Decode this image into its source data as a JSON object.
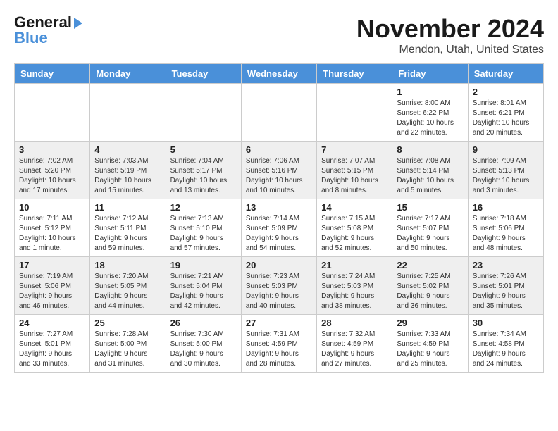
{
  "header": {
    "logo_general": "General",
    "logo_blue": "Blue",
    "month_title": "November 2024",
    "location": "Mendon, Utah, United States"
  },
  "calendar": {
    "days_of_week": [
      "Sunday",
      "Monday",
      "Tuesday",
      "Wednesday",
      "Thursday",
      "Friday",
      "Saturday"
    ],
    "weeks": [
      [
        {
          "day": "",
          "info": ""
        },
        {
          "day": "",
          "info": ""
        },
        {
          "day": "",
          "info": ""
        },
        {
          "day": "",
          "info": ""
        },
        {
          "day": "",
          "info": ""
        },
        {
          "day": "1",
          "info": "Sunrise: 8:00 AM\nSunset: 6:22 PM\nDaylight: 10 hours\nand 22 minutes."
        },
        {
          "day": "2",
          "info": "Sunrise: 8:01 AM\nSunset: 6:21 PM\nDaylight: 10 hours\nand 20 minutes."
        }
      ],
      [
        {
          "day": "3",
          "info": "Sunrise: 7:02 AM\nSunset: 5:20 PM\nDaylight: 10 hours\nand 17 minutes."
        },
        {
          "day": "4",
          "info": "Sunrise: 7:03 AM\nSunset: 5:19 PM\nDaylight: 10 hours\nand 15 minutes."
        },
        {
          "day": "5",
          "info": "Sunrise: 7:04 AM\nSunset: 5:17 PM\nDaylight: 10 hours\nand 13 minutes."
        },
        {
          "day": "6",
          "info": "Sunrise: 7:06 AM\nSunset: 5:16 PM\nDaylight: 10 hours\nand 10 minutes."
        },
        {
          "day": "7",
          "info": "Sunrise: 7:07 AM\nSunset: 5:15 PM\nDaylight: 10 hours\nand 8 minutes."
        },
        {
          "day": "8",
          "info": "Sunrise: 7:08 AM\nSunset: 5:14 PM\nDaylight: 10 hours\nand 5 minutes."
        },
        {
          "day": "9",
          "info": "Sunrise: 7:09 AM\nSunset: 5:13 PM\nDaylight: 10 hours\nand 3 minutes."
        }
      ],
      [
        {
          "day": "10",
          "info": "Sunrise: 7:11 AM\nSunset: 5:12 PM\nDaylight: 10 hours\nand 1 minute."
        },
        {
          "day": "11",
          "info": "Sunrise: 7:12 AM\nSunset: 5:11 PM\nDaylight: 9 hours\nand 59 minutes."
        },
        {
          "day": "12",
          "info": "Sunrise: 7:13 AM\nSunset: 5:10 PM\nDaylight: 9 hours\nand 57 minutes."
        },
        {
          "day": "13",
          "info": "Sunrise: 7:14 AM\nSunset: 5:09 PM\nDaylight: 9 hours\nand 54 minutes."
        },
        {
          "day": "14",
          "info": "Sunrise: 7:15 AM\nSunset: 5:08 PM\nDaylight: 9 hours\nand 52 minutes."
        },
        {
          "day": "15",
          "info": "Sunrise: 7:17 AM\nSunset: 5:07 PM\nDaylight: 9 hours\nand 50 minutes."
        },
        {
          "day": "16",
          "info": "Sunrise: 7:18 AM\nSunset: 5:06 PM\nDaylight: 9 hours\nand 48 minutes."
        }
      ],
      [
        {
          "day": "17",
          "info": "Sunrise: 7:19 AM\nSunset: 5:06 PM\nDaylight: 9 hours\nand 46 minutes."
        },
        {
          "day": "18",
          "info": "Sunrise: 7:20 AM\nSunset: 5:05 PM\nDaylight: 9 hours\nand 44 minutes."
        },
        {
          "day": "19",
          "info": "Sunrise: 7:21 AM\nSunset: 5:04 PM\nDaylight: 9 hours\nand 42 minutes."
        },
        {
          "day": "20",
          "info": "Sunrise: 7:23 AM\nSunset: 5:03 PM\nDaylight: 9 hours\nand 40 minutes."
        },
        {
          "day": "21",
          "info": "Sunrise: 7:24 AM\nSunset: 5:03 PM\nDaylight: 9 hours\nand 38 minutes."
        },
        {
          "day": "22",
          "info": "Sunrise: 7:25 AM\nSunset: 5:02 PM\nDaylight: 9 hours\nand 36 minutes."
        },
        {
          "day": "23",
          "info": "Sunrise: 7:26 AM\nSunset: 5:01 PM\nDaylight: 9 hours\nand 35 minutes."
        }
      ],
      [
        {
          "day": "24",
          "info": "Sunrise: 7:27 AM\nSunset: 5:01 PM\nDaylight: 9 hours\nand 33 minutes."
        },
        {
          "day": "25",
          "info": "Sunrise: 7:28 AM\nSunset: 5:00 PM\nDaylight: 9 hours\nand 31 minutes."
        },
        {
          "day": "26",
          "info": "Sunrise: 7:30 AM\nSunset: 5:00 PM\nDaylight: 9 hours\nand 30 minutes."
        },
        {
          "day": "27",
          "info": "Sunrise: 7:31 AM\nSunset: 4:59 PM\nDaylight: 9 hours\nand 28 minutes."
        },
        {
          "day": "28",
          "info": "Sunrise: 7:32 AM\nSunset: 4:59 PM\nDaylight: 9 hours\nand 27 minutes."
        },
        {
          "day": "29",
          "info": "Sunrise: 7:33 AM\nSunset: 4:59 PM\nDaylight: 9 hours\nand 25 minutes."
        },
        {
          "day": "30",
          "info": "Sunrise: 7:34 AM\nSunset: 4:58 PM\nDaylight: 9 hours\nand 24 minutes."
        }
      ]
    ]
  }
}
